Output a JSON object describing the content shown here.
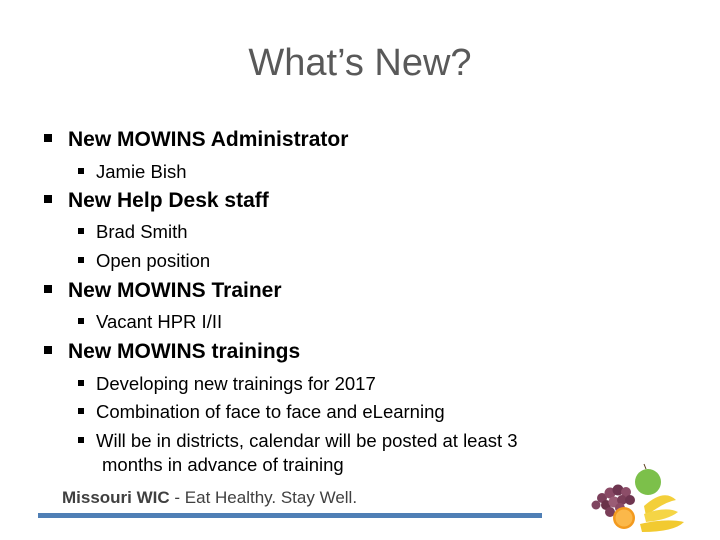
{
  "slide": {
    "title": "What’s New?",
    "sections": [
      {
        "heading": "New MOWINS Administrator",
        "items": [
          "Jamie Bish"
        ]
      },
      {
        "heading": "New Help Desk staff",
        "items": [
          "Brad Smith",
          "Open position"
        ]
      },
      {
        "heading": "New MOWINS Trainer",
        "items": [
          "Vacant HPR I/II"
        ]
      },
      {
        "heading": "New MOWINS trainings",
        "items": [
          "Developing new trainings for 2017",
          "Combination of face to face and eLearning",
          "Will be in districts, calendar will be posted at least 3",
          "months in advance of training"
        ]
      }
    ]
  },
  "footer": {
    "brand": "Missouri WIC",
    "separator": " - ",
    "tagline": "Eat Healthy. Stay Well.",
    "bar_color": "#4f7fb5"
  },
  "image": {
    "icon": "fruit-icon",
    "description": "grapes, green apple, orange half, bananas"
  }
}
